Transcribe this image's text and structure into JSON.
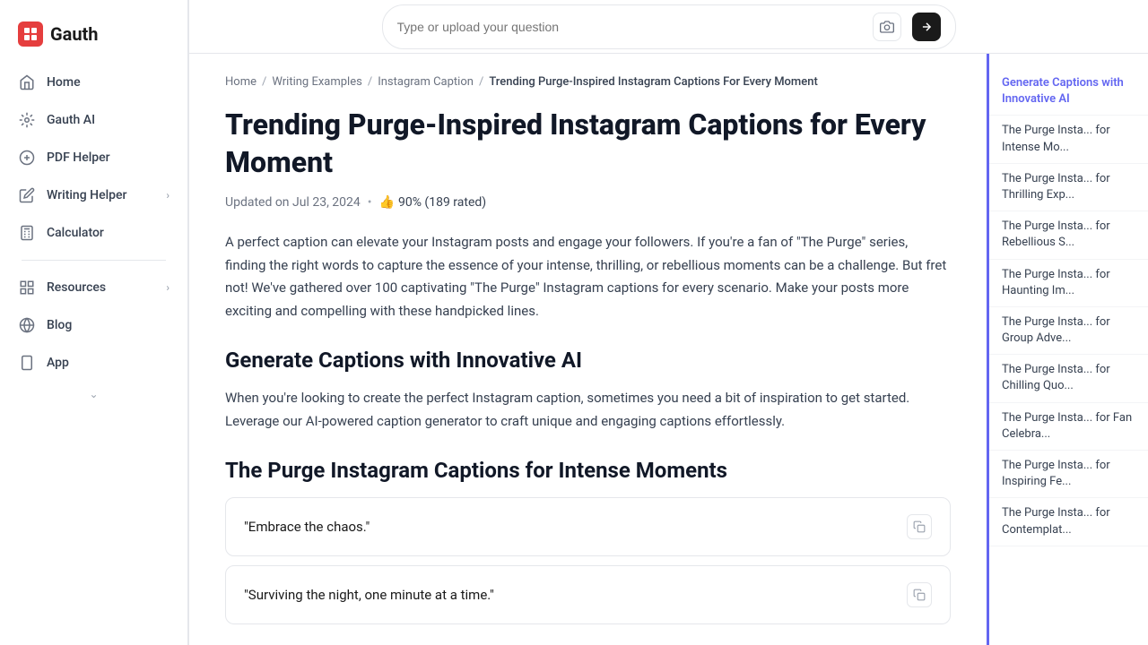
{
  "logo": {
    "icon_text": "G",
    "name": "Gauth"
  },
  "search": {
    "placeholder": "Type or upload your question"
  },
  "sidebar": {
    "items": [
      {
        "id": "home",
        "label": "Home",
        "icon": "home",
        "has_chevron": false
      },
      {
        "id": "gauth-ai",
        "label": "Gauth AI",
        "icon": "ai",
        "has_chevron": false
      },
      {
        "id": "pdf-helper",
        "label": "PDF Helper",
        "icon": "pdf",
        "has_chevron": false
      },
      {
        "id": "writing-helper",
        "label": "Writing Helper",
        "icon": "writing",
        "has_chevron": true
      },
      {
        "id": "calculator",
        "label": "Calculator",
        "icon": "calc",
        "has_chevron": false
      },
      {
        "id": "resources",
        "label": "Resources",
        "icon": "resources",
        "has_chevron": true
      },
      {
        "id": "blog",
        "label": "Blog",
        "icon": "blog",
        "has_chevron": false
      },
      {
        "id": "app",
        "label": "App",
        "icon": "app",
        "has_chevron": false
      }
    ]
  },
  "breadcrumb": {
    "items": [
      {
        "label": "Home",
        "href": "#"
      },
      {
        "label": "Writing Examples",
        "href": "#"
      },
      {
        "label": "Instagram Caption",
        "href": "#"
      },
      {
        "label": "Trending Purge-Inspired Instagram Captions For Every Moment",
        "current": true
      }
    ]
  },
  "article": {
    "title": "Trending Purge-Inspired Instagram Captions for Every Moment",
    "updated": "Updated on Jul 23, 2024",
    "separator": "•",
    "rating_icon": "👍",
    "rating_text": "90% (189 rated)",
    "intro": "A perfect caption can elevate your Instagram posts and engage your followers. If you're a fan of \"The Purge\" series, finding the right words to capture the essence of your intense, thrilling, or rebellious moments can be a challenge. But fret not! We've gathered over 100 captivating \"The Purge\" Instagram captions for every scenario. Make your posts more exciting and compelling with these handpicked lines.",
    "sections": [
      {
        "id": "generate-captions",
        "title": "Generate Captions with Innovative AI",
        "text": "When you're looking to create the perfect Instagram caption, sometimes you need a bit of inspiration to get started. Leverage our AI-powered caption generator to craft unique and engaging captions effortlessly."
      },
      {
        "id": "intense-moments",
        "title": "The Purge Instagram Captions for Intense Moments",
        "captions": [
          "\"Embrace the chaos.\"",
          "\"Surviving the night, one minute at a time.\""
        ]
      }
    ]
  },
  "right_sidebar": {
    "items": [
      {
        "label": "Generate Captions with Innovative AI",
        "active": true
      },
      {
        "label": "The Purge Insta... for Intense Mo..."
      },
      {
        "label": "The Purge Insta... for Thrilling Exp..."
      },
      {
        "label": "The Purge Insta... for Rebellious S..."
      },
      {
        "label": "The Purge Insta... for Haunting Im..."
      },
      {
        "label": "The Purge Insta... for Group Adve..."
      },
      {
        "label": "The Purge Insta... for Chilling Quo..."
      },
      {
        "label": "The Purge Insta... for Fan Celebra..."
      },
      {
        "label": "The Purge Insta... for Inspiring Fe..."
      },
      {
        "label": "The Purge Insta... for Contemplat..."
      }
    ]
  }
}
